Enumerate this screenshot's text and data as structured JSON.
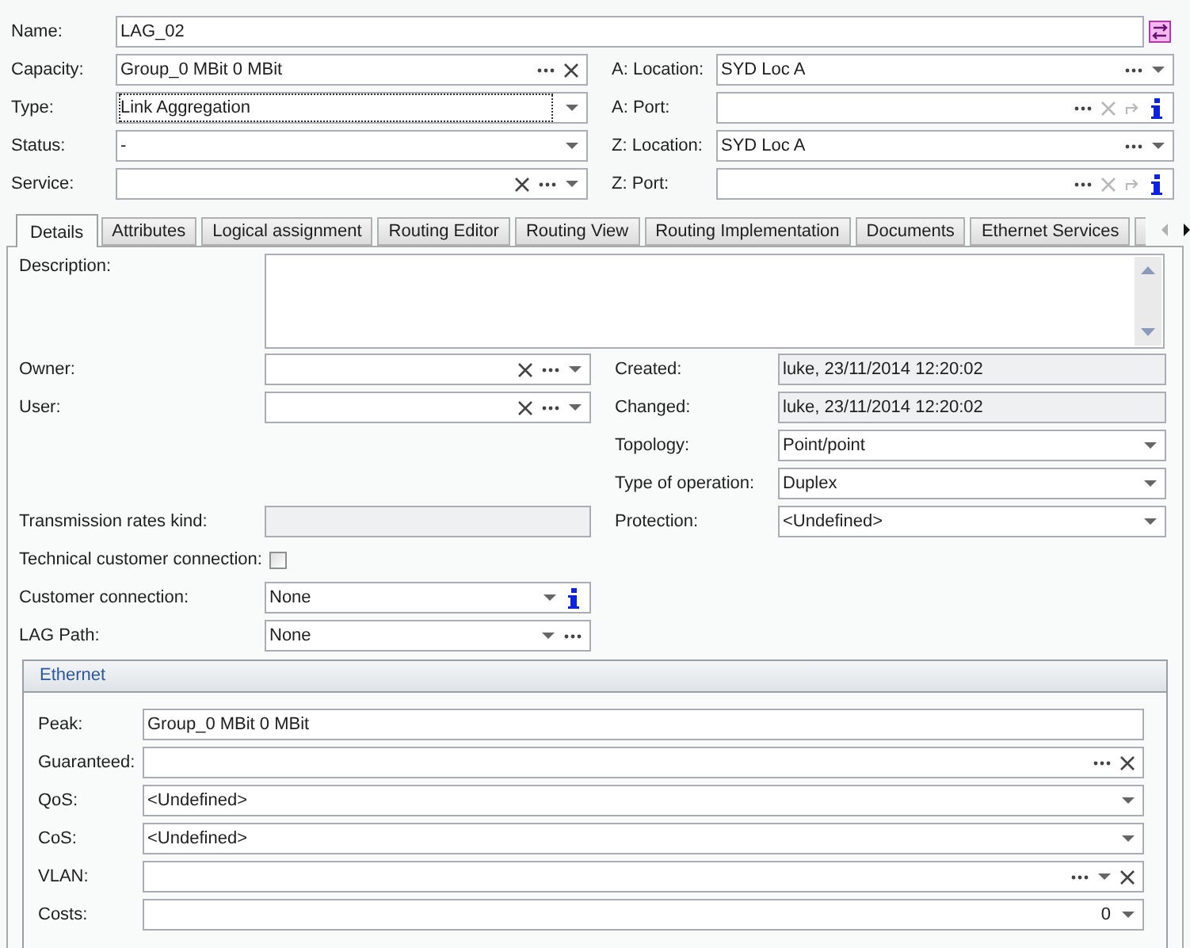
{
  "name_field": {
    "label": "Name:",
    "value": "LAG_02"
  },
  "top_rows": [
    {
      "left": {
        "label": "Capacity:",
        "value": "Group_0 MBit 0 MBit",
        "focused": false,
        "buttons": [
          {
            "kind": "more",
            "disabled": false
          },
          {
            "kind": "clear",
            "disabled": false
          }
        ]
      },
      "right": {
        "label": "A: Location:",
        "value": "SYD Loc A",
        "focused": false,
        "buttons": [
          {
            "kind": "more",
            "disabled": false
          },
          {
            "kind": "dropdown",
            "disabled": false
          }
        ]
      }
    },
    {
      "left": {
        "label": "Type:",
        "value": "Link Aggregation",
        "focused": true,
        "buttons": [
          {
            "kind": "dropdown",
            "disabled": false
          }
        ]
      },
      "right": {
        "label": "A: Port:",
        "focused": false,
        "buttons": [
          {
            "kind": "more",
            "disabled": false
          },
          {
            "kind": "clear",
            "disabled": true
          },
          {
            "kind": "redo",
            "disabled": true
          },
          {
            "kind": "info",
            "disabled": false
          }
        ]
      }
    },
    {
      "left": {
        "label": "Status:",
        "value": "-",
        "focused": false,
        "buttons": [
          {
            "kind": "dropdown",
            "disabled": false
          }
        ]
      },
      "right": {
        "label": "Z: Location:",
        "value": "SYD Loc A",
        "focused": false,
        "buttons": [
          {
            "kind": "more",
            "disabled": false
          },
          {
            "kind": "dropdown",
            "disabled": false
          }
        ]
      }
    },
    {
      "left": {
        "label": "Service:",
        "focused": false,
        "buttons": [
          {
            "kind": "clear",
            "disabled": false
          },
          {
            "kind": "more",
            "disabled": false
          },
          {
            "kind": "dropdown",
            "disabled": false
          }
        ]
      },
      "right": {
        "label": "Z: Port:",
        "focused": false,
        "buttons": [
          {
            "kind": "more",
            "disabled": false
          },
          {
            "kind": "clear",
            "disabled": true
          },
          {
            "kind": "redo",
            "disabled": true
          },
          {
            "kind": "info",
            "disabled": false
          }
        ]
      }
    }
  ],
  "tabs": [
    {
      "label": "Details",
      "selected": true
    },
    {
      "label": "Attributes",
      "selected": false
    },
    {
      "label": "Logical assignment",
      "selected": false
    },
    {
      "label": "Routing Editor",
      "selected": false
    },
    {
      "label": "Routing View",
      "selected": false
    },
    {
      "label": "Routing Implementation",
      "selected": false
    },
    {
      "label": "Documents",
      "selected": false
    },
    {
      "label": "Ethernet Services",
      "selected": false
    }
  ],
  "tab_scroll": [
    {
      "kind": "left",
      "disabled": true
    },
    {
      "kind": "right",
      "disabled": false
    }
  ],
  "description": {
    "label": "Description:"
  },
  "detail_rows": [
    {
      "left": {
        "kind": "field",
        "label": "Owner:",
        "disabled": false,
        "buttons": [
          {
            "kind": "clear",
            "disabled": false
          },
          {
            "kind": "more",
            "disabled": false
          },
          {
            "kind": "dropdown",
            "disabled": false
          }
        ]
      },
      "right": {
        "kind": "field",
        "label": "Created:",
        "value": "luke, 23/11/2014 12:20:02",
        "disabled": true
      }
    },
    {
      "left": {
        "kind": "field",
        "label": "User:",
        "disabled": false,
        "buttons": [
          {
            "kind": "clear",
            "disabled": false
          },
          {
            "kind": "more",
            "disabled": false
          },
          {
            "kind": "dropdown",
            "disabled": false
          }
        ]
      },
      "right": {
        "kind": "field",
        "label": "Changed:",
        "value": "luke, 23/11/2014 12:20:02",
        "disabled": true
      }
    },
    {
      "right": {
        "kind": "field",
        "label": "Topology:",
        "value": "Point/point",
        "disabled": false,
        "buttons": [
          {
            "kind": "dropdown",
            "disabled": false
          }
        ]
      }
    },
    {
      "right": {
        "kind": "field",
        "label": "Type of operation:",
        "value": "Duplex",
        "disabled": false,
        "buttons": [
          {
            "kind": "dropdown",
            "disabled": false
          }
        ]
      }
    },
    {
      "left": {
        "kind": "field",
        "label": "Transmission rates kind:",
        "disabled": true
      },
      "right": {
        "kind": "field",
        "label": "Protection:",
        "value": "<Undefined>",
        "disabled": false,
        "buttons": [
          {
            "kind": "dropdown",
            "disabled": false
          }
        ]
      }
    },
    {
      "left": {
        "kind": "checkbox",
        "label": "Technical customer connection:",
        "checked": false
      }
    },
    {
      "left": {
        "kind": "field",
        "label": "Customer connection:",
        "value": "None",
        "disabled": false,
        "buttons": [
          {
            "kind": "dropdown",
            "disabled": false
          },
          {
            "kind": "info",
            "disabled": false
          }
        ]
      }
    },
    {
      "left": {
        "kind": "field",
        "label": "LAG Path:",
        "value": "None",
        "disabled": false,
        "buttons": [
          {
            "kind": "dropdown",
            "disabled": false
          },
          {
            "kind": "more",
            "disabled": false
          }
        ]
      }
    }
  ],
  "ethernet": {
    "title": "Ethernet",
    "rows": [
      {
        "kind": "text",
        "label": "Peak:",
        "value": "Group_0 MBit 0 MBit"
      },
      {
        "kind": "text",
        "label": "Guaranteed:",
        "buttons": [
          {
            "kind": "more",
            "disabled": false
          },
          {
            "kind": "clear",
            "disabled": false
          }
        ]
      },
      {
        "kind": "text",
        "label": "QoS:",
        "value": "<Undefined>",
        "buttons": [
          {
            "kind": "dropdown",
            "disabled": false
          }
        ]
      },
      {
        "kind": "text",
        "label": "CoS:",
        "value": "<Undefined>",
        "buttons": [
          {
            "kind": "dropdown",
            "disabled": false
          }
        ]
      },
      {
        "kind": "text",
        "label": "VLAN:",
        "buttons": [
          {
            "kind": "more",
            "disabled": false
          },
          {
            "kind": "dropdown",
            "disabled": false
          },
          {
            "kind": "clear",
            "disabled": false
          }
        ]
      },
      {
        "kind": "number",
        "label": "Costs:",
        "value": "0",
        "buttons": [
          {
            "kind": "dropdown",
            "disabled": false
          }
        ]
      }
    ]
  }
}
